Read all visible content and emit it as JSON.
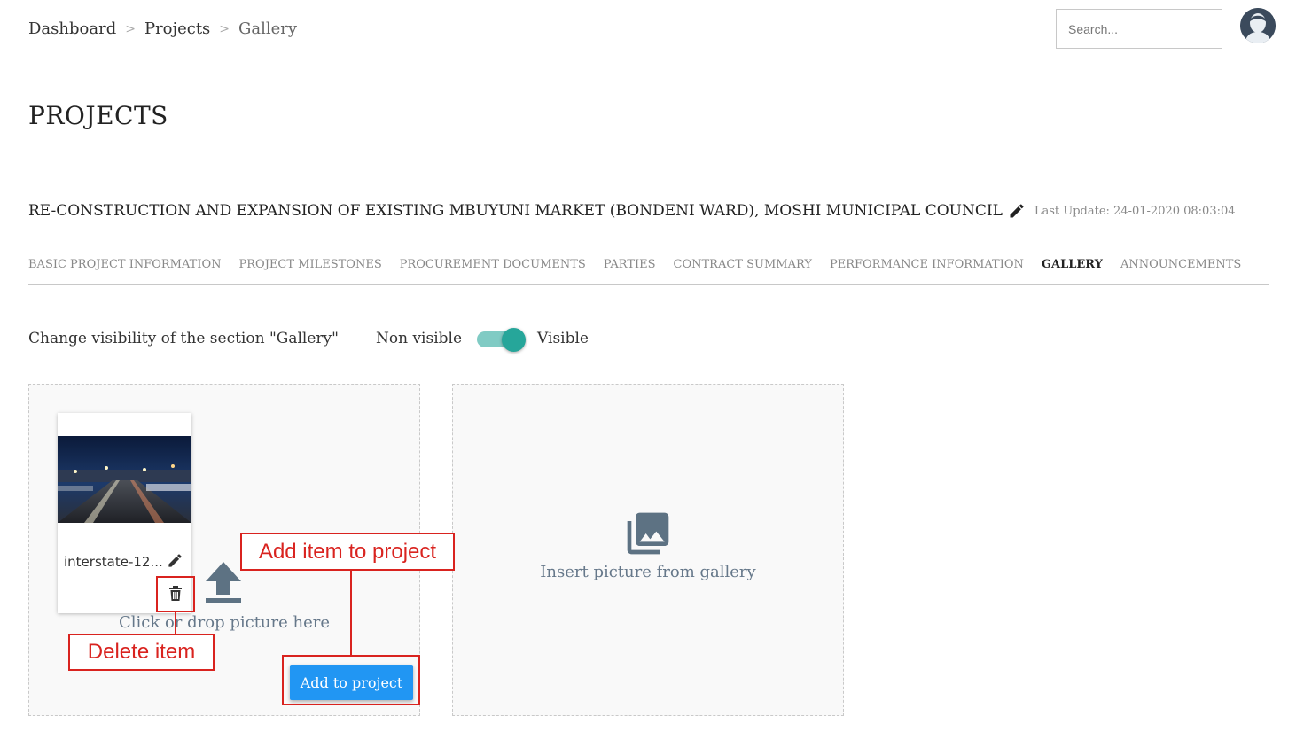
{
  "breadcrumb": {
    "items": [
      "Dashboard",
      "Projects",
      "Gallery"
    ],
    "separator": ">"
  },
  "search": {
    "placeholder": "Search..."
  },
  "page": {
    "title": "PROJECTS"
  },
  "project": {
    "name": "RE-CONSTRUCTION AND EXPANSION OF EXISTING MBUYUNI MARKET (BONDENI WARD), MOSHI MUNICIPAL COUNCIL",
    "last_update": "Last Update: 24-01-2020 08:03:04"
  },
  "tabs": [
    {
      "label": "BASIC PROJECT INFORMATION",
      "active": false
    },
    {
      "label": "PROJECT MILESTONES",
      "active": false
    },
    {
      "label": "PROCUREMENT DOCUMENTS",
      "active": false
    },
    {
      "label": "PARTIES",
      "active": false
    },
    {
      "label": "CONTRACT SUMMARY",
      "active": false
    },
    {
      "label": "PERFORMANCE INFORMATION",
      "active": false
    },
    {
      "label": "GALLERY",
      "active": true
    },
    {
      "label": "ANNOUNCEMENTS",
      "active": false
    }
  ],
  "visibility": {
    "label": "Change visibility of the section \"Gallery\"",
    "off_label": "Non visible",
    "on_label": "Visible",
    "enabled": true
  },
  "upload_zone": {
    "thumbnail_name": "interstate-12...",
    "hint": "Click or drop picture here",
    "add_button": "Add to project"
  },
  "gallery_zone": {
    "hint": "Insert picture from gallery"
  },
  "annotations": {
    "add_item": "Add item to project",
    "delete_item": "Delete item"
  },
  "colors": {
    "accent": "#2196f3",
    "toggle_on": "#26a69a",
    "annotation": "#d9231f",
    "hint_text": "#66788a"
  },
  "icons": [
    "pencil-icon",
    "trash-icon",
    "upload-icon",
    "photo-library-icon",
    "avatar-icon"
  ]
}
